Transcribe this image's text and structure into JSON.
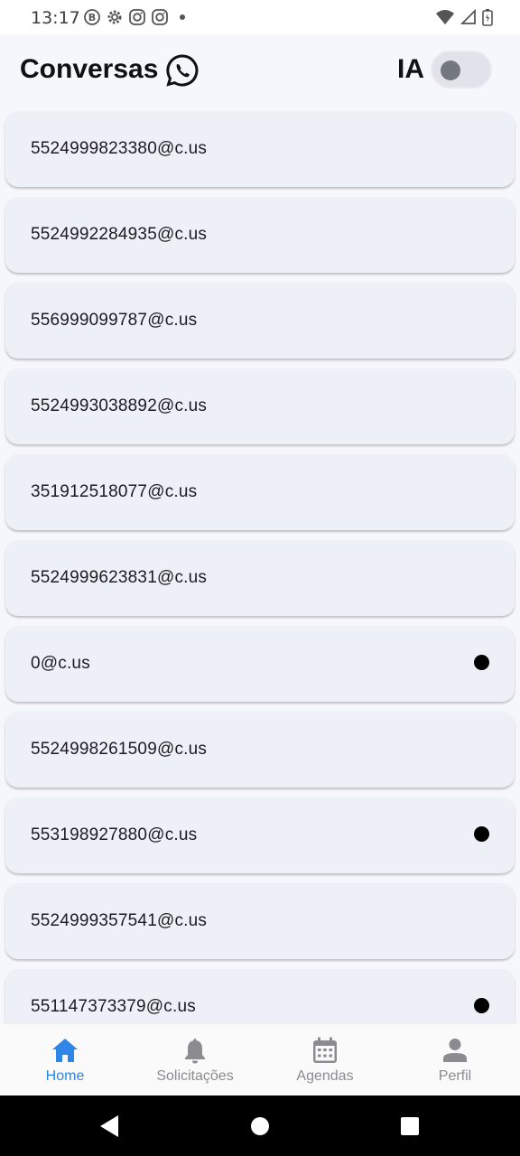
{
  "status_bar": {
    "time": "13:17",
    "left_icons": [
      "b-circle-icon",
      "gear-icon",
      "instagram-icon",
      "instagram-icon",
      "dot-icon"
    ],
    "right_icons": [
      "wifi-icon",
      "signal-icon",
      "battery-icon"
    ]
  },
  "header": {
    "title": "Conversas",
    "title_icon": "whatsapp-icon",
    "ia_label": "IA",
    "ia_toggle_on": false
  },
  "conversations": [
    {
      "id": "5524999823380@c.us",
      "unread": false
    },
    {
      "id": "5524992284935@c.us",
      "unread": false
    },
    {
      "id": "556999099787@c.us",
      "unread": false
    },
    {
      "id": "5524993038892@c.us",
      "unread": false
    },
    {
      "id": "351912518077@c.us",
      "unread": false
    },
    {
      "id": "5524999623831@c.us",
      "unread": false
    },
    {
      "id": "0@c.us",
      "unread": true
    },
    {
      "id": "5524998261509@c.us",
      "unread": false
    },
    {
      "id": "553198927880@c.us",
      "unread": true
    },
    {
      "id": "5524999357541@c.us",
      "unread": false
    },
    {
      "id": "551147373379@c.us",
      "unread": true
    }
  ],
  "bottom_nav": {
    "items": [
      {
        "label": "Home",
        "icon": "home-icon",
        "active": true
      },
      {
        "label": "Solicitações",
        "icon": "bell-icon",
        "active": false
      },
      {
        "label": "Agendas",
        "icon": "calendar-icon",
        "active": false
      },
      {
        "label": "Perfil",
        "icon": "person-icon",
        "active": false
      }
    ]
  },
  "colors": {
    "accent": "#2e86e6",
    "inactive": "#8c8c90",
    "card": "#eef0f8",
    "background": "#f6f7fc"
  }
}
